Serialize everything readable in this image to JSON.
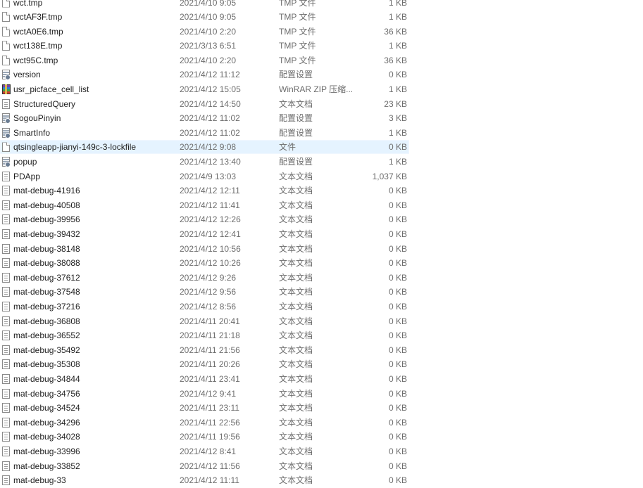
{
  "files": [
    {
      "name": "wct.tmp",
      "date": "2021/4/10 9:05",
      "type": "TMP 文件",
      "size": "1 KB",
      "icon": "blank-file-icon"
    },
    {
      "name": "wctAF3F.tmp",
      "date": "2021/4/10 9:05",
      "type": "TMP 文件",
      "size": "1 KB",
      "icon": "blank-file-icon"
    },
    {
      "name": "wctA0E6.tmp",
      "date": "2021/4/10 2:20",
      "type": "TMP 文件",
      "size": "36 KB",
      "icon": "blank-file-icon"
    },
    {
      "name": "wct138E.tmp",
      "date": "2021/3/13 6:51",
      "type": "TMP 文件",
      "size": "1 KB",
      "icon": "blank-file-icon"
    },
    {
      "name": "wct95C.tmp",
      "date": "2021/4/10 2:20",
      "type": "TMP 文件",
      "size": "36 KB",
      "icon": "blank-file-icon"
    },
    {
      "name": "version",
      "date": "2021/4/12 11:12",
      "type": "配置设置",
      "size": "0 KB",
      "icon": "config-file-icon"
    },
    {
      "name": "usr_picface_cell_list",
      "date": "2021/4/12 15:05",
      "type": "WinRAR ZIP 压缩...",
      "size": "1 KB",
      "icon": "winrar-archive-icon"
    },
    {
      "name": "StructuredQuery",
      "date": "2021/4/12 14:50",
      "type": "文本文档",
      "size": "23 KB",
      "icon": "text-file-icon"
    },
    {
      "name": "SogouPinyin",
      "date": "2021/4/12 11:02",
      "type": "配置设置",
      "size": "3 KB",
      "icon": "config-file-icon"
    },
    {
      "name": "SmartInfo",
      "date": "2021/4/12 11:02",
      "type": "配置设置",
      "size": "1 KB",
      "icon": "config-file-icon"
    },
    {
      "name": "qtsingleapp-jianyi-149c-3-lockfile",
      "date": "2021/4/12 9:08",
      "type": "文件",
      "size": "0 KB",
      "icon": "blank-file-icon",
      "selected": true
    },
    {
      "name": "popup",
      "date": "2021/4/12 13:40",
      "type": "配置设置",
      "size": "1 KB",
      "icon": "config-file-icon"
    },
    {
      "name": "PDApp",
      "date": "2021/4/9 13:03",
      "type": "文本文档",
      "size": "1,037 KB",
      "icon": "text-file-icon"
    },
    {
      "name": "mat-debug-41916",
      "date": "2021/4/12 12:11",
      "type": "文本文档",
      "size": "0 KB",
      "icon": "text-file-icon"
    },
    {
      "name": "mat-debug-40508",
      "date": "2021/4/12 11:41",
      "type": "文本文档",
      "size": "0 KB",
      "icon": "text-file-icon"
    },
    {
      "name": "mat-debug-39956",
      "date": "2021/4/12 12:26",
      "type": "文本文档",
      "size": "0 KB",
      "icon": "text-file-icon"
    },
    {
      "name": "mat-debug-39432",
      "date": "2021/4/12 12:41",
      "type": "文本文档",
      "size": "0 KB",
      "icon": "text-file-icon"
    },
    {
      "name": "mat-debug-38148",
      "date": "2021/4/12 10:56",
      "type": "文本文档",
      "size": "0 KB",
      "icon": "text-file-icon"
    },
    {
      "name": "mat-debug-38088",
      "date": "2021/4/12 10:26",
      "type": "文本文档",
      "size": "0 KB",
      "icon": "text-file-icon"
    },
    {
      "name": "mat-debug-37612",
      "date": "2021/4/12 9:26",
      "type": "文本文档",
      "size": "0 KB",
      "icon": "text-file-icon"
    },
    {
      "name": "mat-debug-37548",
      "date": "2021/4/12 9:56",
      "type": "文本文档",
      "size": "0 KB",
      "icon": "text-file-icon"
    },
    {
      "name": "mat-debug-37216",
      "date": "2021/4/12 8:56",
      "type": "文本文档",
      "size": "0 KB",
      "icon": "text-file-icon"
    },
    {
      "name": "mat-debug-36808",
      "date": "2021/4/11 20:41",
      "type": "文本文档",
      "size": "0 KB",
      "icon": "text-file-icon"
    },
    {
      "name": "mat-debug-36552",
      "date": "2021/4/11 21:18",
      "type": "文本文档",
      "size": "0 KB",
      "icon": "text-file-icon"
    },
    {
      "name": "mat-debug-35492",
      "date": "2021/4/11 21:56",
      "type": "文本文档",
      "size": "0 KB",
      "icon": "text-file-icon"
    },
    {
      "name": "mat-debug-35308",
      "date": "2021/4/11 20:26",
      "type": "文本文档",
      "size": "0 KB",
      "icon": "text-file-icon"
    },
    {
      "name": "mat-debug-34844",
      "date": "2021/4/11 23:41",
      "type": "文本文档",
      "size": "0 KB",
      "icon": "text-file-icon"
    },
    {
      "name": "mat-debug-34756",
      "date": "2021/4/12 9:41",
      "type": "文本文档",
      "size": "0 KB",
      "icon": "text-file-icon"
    },
    {
      "name": "mat-debug-34524",
      "date": "2021/4/11 23:11",
      "type": "文本文档",
      "size": "0 KB",
      "icon": "text-file-icon"
    },
    {
      "name": "mat-debug-34296",
      "date": "2021/4/11 22:56",
      "type": "文本文档",
      "size": "0 KB",
      "icon": "text-file-icon"
    },
    {
      "name": "mat-debug-34028",
      "date": "2021/4/11 19:56",
      "type": "文本文档",
      "size": "0 KB",
      "icon": "text-file-icon"
    },
    {
      "name": "mat-debug-33996",
      "date": "2021/4/12 8:41",
      "type": "文本文档",
      "size": "0 KB",
      "icon": "text-file-icon"
    },
    {
      "name": "mat-debug-33852",
      "date": "2021/4/12 11:56",
      "type": "文本文档",
      "size": "0 KB",
      "icon": "text-file-icon"
    },
    {
      "name": "mat-debug-33",
      "date": "2021/4/12 11:11",
      "type": "文本文档",
      "size": "0 KB",
      "icon": "text-file-icon"
    }
  ],
  "colors": {
    "selection": "#e5f3ff",
    "secondary_text": "#6d6d6d",
    "primary_text": "#1e1e1e"
  }
}
